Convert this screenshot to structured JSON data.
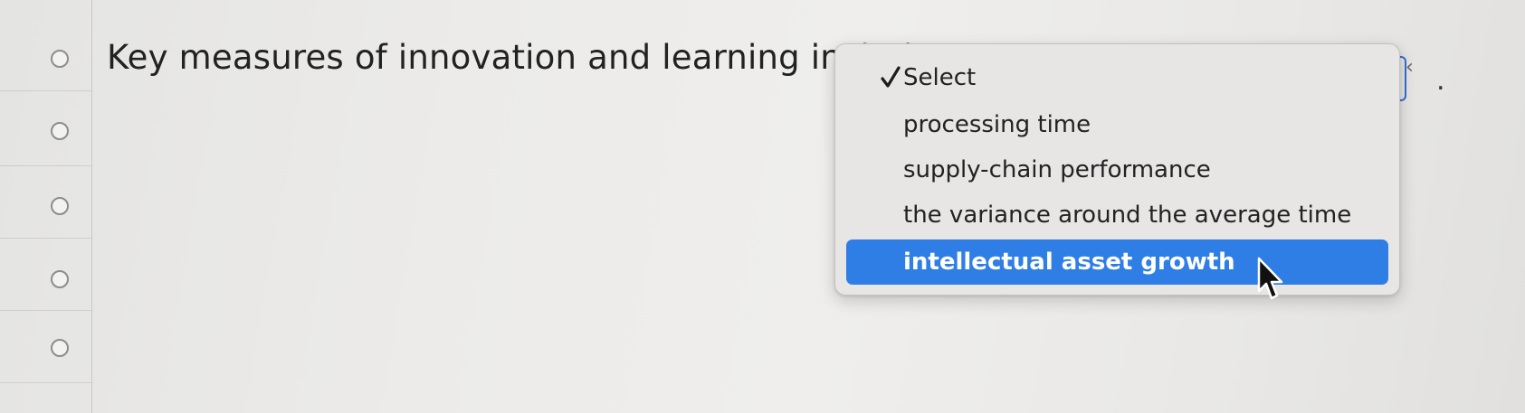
{
  "question": {
    "text": "Key measures of innovation and learning include"
  },
  "select": {
    "trailing_text": "."
  },
  "dropdown": {
    "options": [
      {
        "label": "Select",
        "checked": true,
        "highlighted": false
      },
      {
        "label": "processing time",
        "checked": false,
        "highlighted": false
      },
      {
        "label": "supply-chain performance",
        "checked": false,
        "highlighted": false
      },
      {
        "label": "the variance around the average time",
        "checked": false,
        "highlighted": false
      },
      {
        "label": "intellectual asset growth",
        "checked": false,
        "highlighted": true
      }
    ]
  },
  "colors": {
    "highlight": "#2f7ee5",
    "focus_ring": "#2f6fd6"
  },
  "icons": {
    "check": "checkmark-icon",
    "cursor": "mouse-pointer-icon",
    "radio": "radio-button-icon"
  }
}
